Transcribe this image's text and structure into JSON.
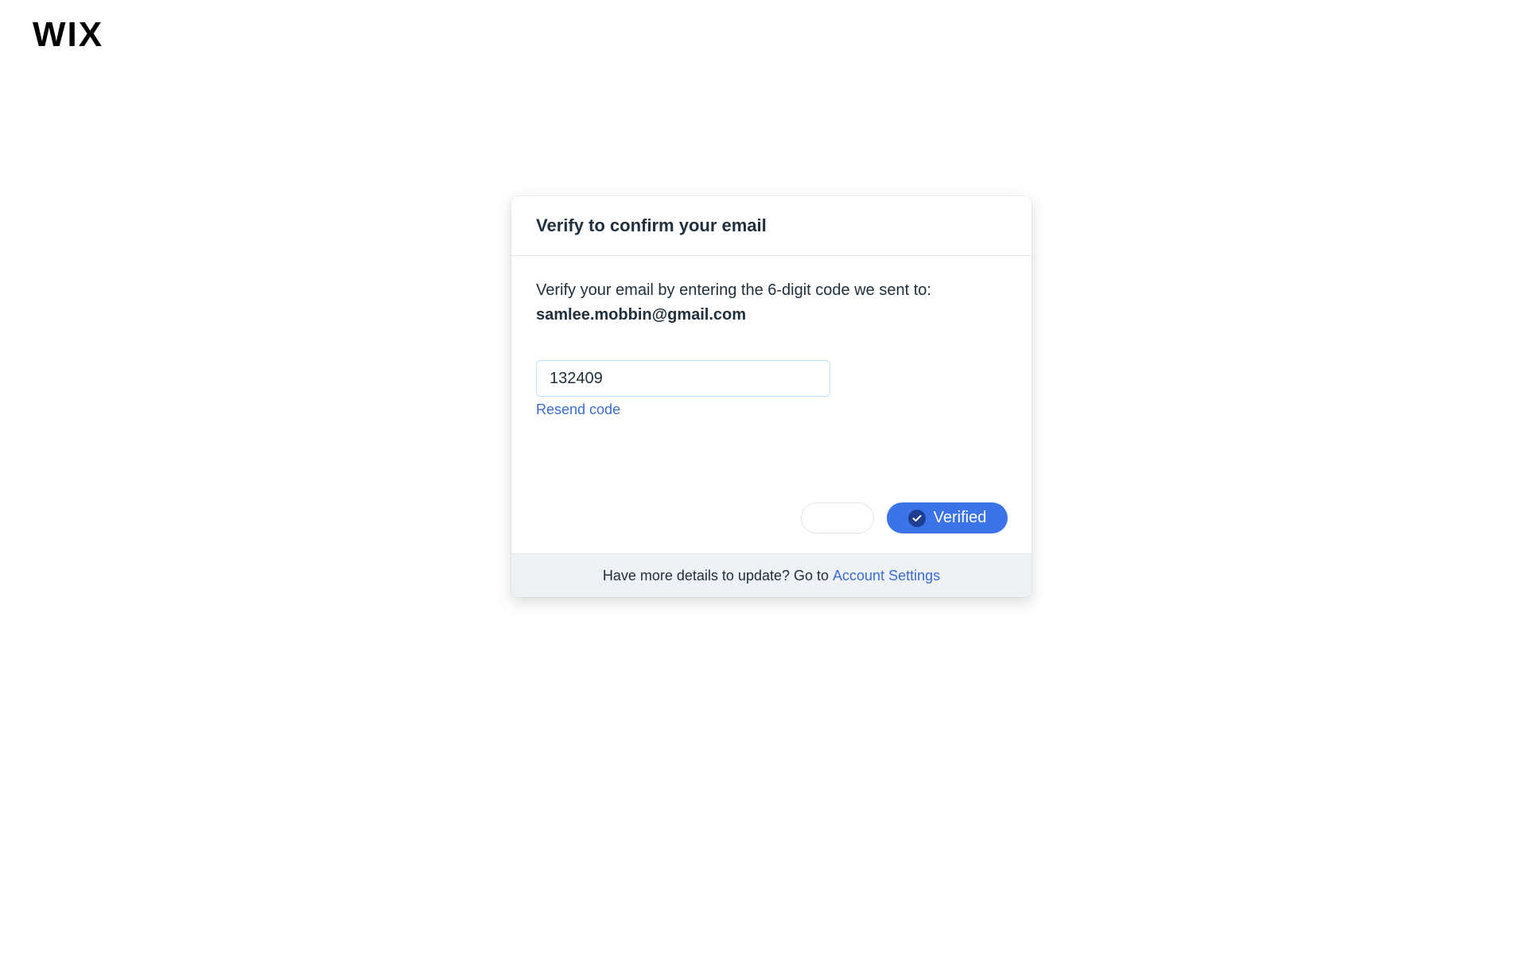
{
  "brand": {
    "logo_text": "WIX"
  },
  "dialog": {
    "title": "Verify to confirm your email",
    "instruction": "Verify your email by entering the 6-digit code we sent to:",
    "email": "samlee.mobbin@gmail.com",
    "code_input": {
      "value": "132409",
      "placeholder": ""
    },
    "resend_label": "Resend code",
    "secondary_button_label": "",
    "verified_button_label": "Verified",
    "footer": {
      "prompt": "Have more details to update? Go to",
      "link_label": "Account Settings"
    }
  },
  "colors": {
    "primary": "#3b73e8",
    "link": "#3b6ccf",
    "text": "#20303c",
    "footer_bg": "#eef1f5"
  },
  "icons": {
    "verified": "check-circle-icon"
  }
}
